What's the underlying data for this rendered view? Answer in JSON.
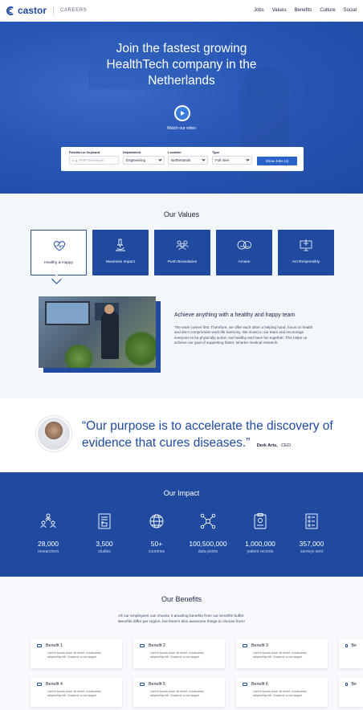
{
  "nav": {
    "brand": "castor",
    "section": "CAREERS",
    "links": [
      "Jobs",
      "Values",
      "Benefits",
      "Culture",
      "Social"
    ]
  },
  "hero": {
    "title_lines": [
      "Join the fastest growing",
      "HealthTech company in the",
      "Netherlands"
    ],
    "watch_label": "Watch our video",
    "search": {
      "position_label": "Position or keyword",
      "position_placeholder": "e.g. PHP Developer",
      "department_label": "Department",
      "department_value": "Engineering",
      "location_label": "Location",
      "location_value": "Netherlands",
      "type_label": "Type",
      "type_value": "Full time",
      "button_label": "Show Jobs (4)"
    }
  },
  "values": {
    "title": "Our Values",
    "items": [
      {
        "label": "Healthy & Happy",
        "icon": "heart-pulse-icon",
        "active": true
      },
      {
        "label": "Maximise Impact",
        "icon": "microscope-icon",
        "active": false
      },
      {
        "label": "Push Boundaries",
        "icon": "people-icon",
        "active": false
      },
      {
        "label": "Amaze",
        "icon": "smiley-faces-icon",
        "active": false
      },
      {
        "label": "Act Responsibly",
        "icon": "monitor-icon",
        "active": false
      }
    ],
    "detail_title": "Achieve anything with a healthy and happy team",
    "detail_text": "The team comes first. Therefore, we offer each other a helping hand, focus on health and don't compromise work-life harmony. We invest in our team and encourage everyone to be physically active, eat healthy and have fun together. This helps us achieve our goal of supporting faster, smarter medical research."
  },
  "quote": {
    "text": "“Our purpose is to accelerate the discovery of evidence that cures diseases.”",
    "author": "Derk Arts,",
    "role": "CEO"
  },
  "impact": {
    "title": "Our Impact",
    "stats": [
      {
        "value": "28,000",
        "label": "researchers",
        "icon": "researchers-icon"
      },
      {
        "value": "3,500",
        "label": "studies",
        "icon": "studies-icon"
      },
      {
        "value": "50+",
        "label": "countries",
        "icon": "globe-icon"
      },
      {
        "value": "100,500,000",
        "label": "data points",
        "icon": "network-icon"
      },
      {
        "value": "1,000,000",
        "label": "patient records",
        "icon": "patient-record-icon"
      },
      {
        "value": "357,000",
        "label": "surveys sent",
        "icon": "survey-icon"
      }
    ]
  },
  "benefits": {
    "title": "Our Benefits",
    "subtitle_lines": [
      "All our employees can choose 3 amazing benefits from our benefits buffet.",
      "Benefits differ per region, but there's also awesome things to choose from!"
    ],
    "items": [
      {
        "title": "Benefit 1",
        "text": "Lorem ipsum dolor sit amet, consectetur adipiscing elit. Vivamus a orci augue."
      },
      {
        "title": "Benefit 2",
        "text": "Lorem ipsum dolor sit amet, consectetur adipiscing elit. Vivamus a orci augue."
      },
      {
        "title": "Benefit 3",
        "text": "Lorem ipsum dolor sit amet, consectetur adipiscing elit. Vivamus a orci augue."
      },
      {
        "title": "Be",
        "text": ""
      },
      {
        "title": "Benefit 4",
        "text": "Lorem ipsum dolor sit amet, consectetur adipiscing elit. Vivamus a orci augue."
      },
      {
        "title": "Benefit 5",
        "text": "Lorem ipsum dolor sit amet, consectetur adipiscing elit. Vivamus a orci augue."
      },
      {
        "title": "Benefit 6",
        "text": "Lorem ipsum dolor sit amet, consectetur adipiscing elit. Vivamus a orci augue."
      },
      {
        "title": "Be",
        "text": ""
      }
    ]
  },
  "colors": {
    "brand": "#1f4aa0",
    "hero": "#2a58b8",
    "accent_button": "#2a62cc"
  }
}
